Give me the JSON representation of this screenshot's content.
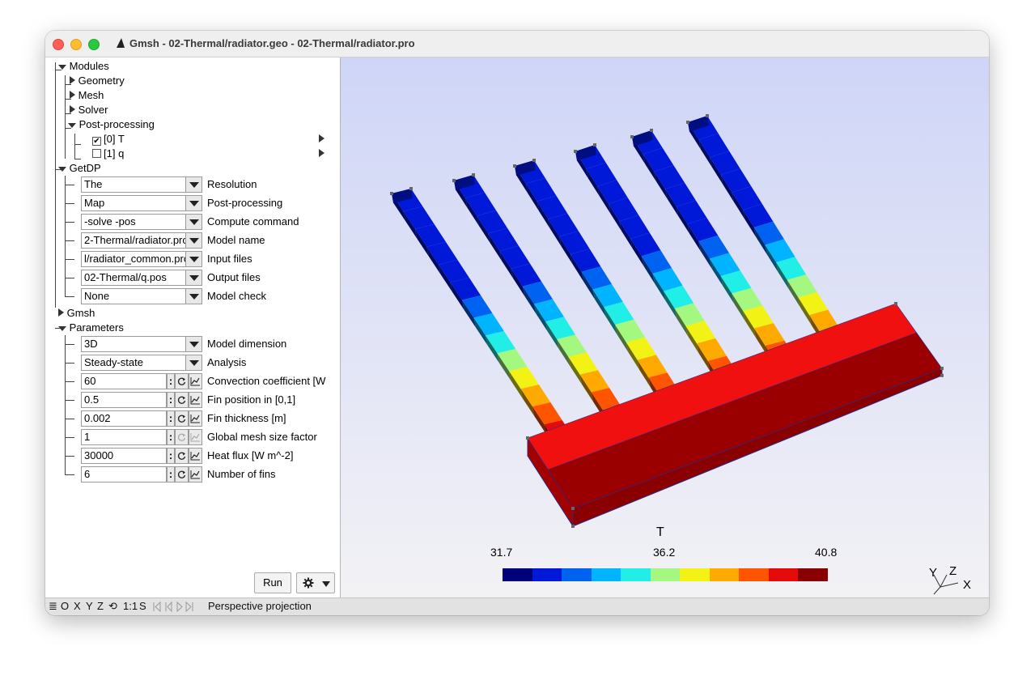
{
  "window": {
    "title": "Gmsh - 02-Thermal/radiator.geo - 02-Thermal/radiator.pro"
  },
  "tree": {
    "modules": "Modules",
    "geometry": "Geometry",
    "mesh": "Mesh",
    "solver": "Solver",
    "postprocessing": "Post-processing",
    "view0": "[0] T",
    "view1": "[1] q",
    "getdp": "GetDP",
    "gmsh": "Gmsh",
    "parameters": "Parameters"
  },
  "getdp_fields": [
    {
      "value": "The",
      "label": "Resolution"
    },
    {
      "value": "Map",
      "label": "Post-processing"
    },
    {
      "value": "-solve -pos",
      "label": "Compute command"
    },
    {
      "value": "2-Thermal/radiator.pro",
      "label": "Model name"
    },
    {
      "value": "l/radiator_common.pro",
      "label": "Input files"
    },
    {
      "value": "02-Thermal/q.pos",
      "label": "Output files"
    },
    {
      "value": "None",
      "label": "Model check"
    }
  ],
  "parameters": {
    "choices": [
      {
        "value": "3D",
        "label": "Model dimension"
      },
      {
        "value": "Steady-state",
        "label": "Analysis"
      }
    ],
    "numbers": [
      {
        "value": "60",
        "label": "Convection coefficient [W"
      },
      {
        "value": "0.5",
        "label": "Fin position in [0,1]"
      },
      {
        "value": "0.002",
        "label": "Fin thickness [m]"
      },
      {
        "value": "1",
        "label": "Global mesh size factor"
      },
      {
        "value": "30000",
        "label": "Heat flux [W m^-2]"
      },
      {
        "value": "6",
        "label": "Number of fins"
      }
    ]
  },
  "buttons": {
    "run": "Run",
    "gear_icon": "gear-icon"
  },
  "statusbar": {
    "menu_icon": "≣",
    "o": "O",
    "x": "X",
    "y": "Y",
    "z": "Z",
    "rotate_icon": "⟲",
    "scale": "1:1",
    "s": "S",
    "message": "Perspective projection"
  },
  "colorbar": {
    "title": "T",
    "min_label": "31.7",
    "mid_label": "36.2",
    "max_label": "40.8",
    "colors": [
      "#00007a",
      "#0018d8",
      "#0062f0",
      "#00b4ff",
      "#22eee8",
      "#a4f880",
      "#f2f214",
      "#ffaa00",
      "#ff5500",
      "#e60b0b",
      "#8a0000"
    ]
  },
  "axes": {
    "y": "Y",
    "z": "Z",
    "x": "X"
  }
}
